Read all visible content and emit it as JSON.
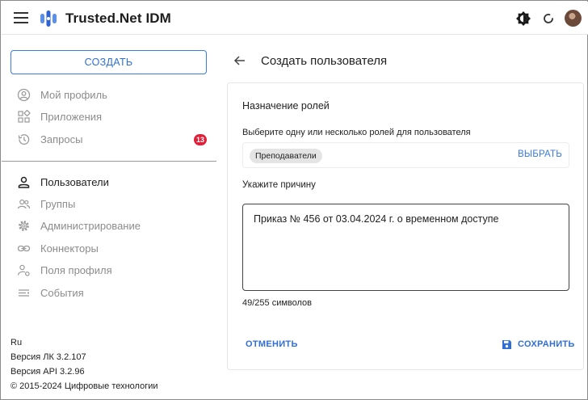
{
  "header": {
    "app_title": "Trusted.Net IDM",
    "icons": [
      "menu-icon",
      "app-logo",
      "theme-toggle-icon",
      "refresh-icon",
      "avatar"
    ]
  },
  "sidebar": {
    "create_label": "СОЗДАТЬ",
    "items_top": [
      {
        "label": "Мой профиль",
        "icon": "user-circle-icon"
      },
      {
        "label": "Приложения",
        "icon": "apps-icon"
      },
      {
        "label": "Запросы",
        "icon": "history-icon",
        "badge": "13"
      }
    ],
    "items_bottom": [
      {
        "label": "Пользователи",
        "icon": "user-icon",
        "active": true
      },
      {
        "label": "Группы",
        "icon": "group-icon"
      },
      {
        "label": "Администрирование",
        "icon": "gear-icon"
      },
      {
        "label": "Коннекторы",
        "icon": "link-icon"
      },
      {
        "label": "Поля профиля",
        "icon": "profile-fields-icon"
      },
      {
        "label": "События",
        "icon": "events-icon"
      }
    ],
    "footer": {
      "language": "Ru",
      "lk_version": "Версия ЛК 3.2.107",
      "api_version": "Версия API 3.2.96",
      "copyright": "© 2015-2024 Цифровые технологии"
    }
  },
  "main": {
    "page_title": "Создать пользователя",
    "card": {
      "section_title": "Назначение ролей",
      "roles_hint": "Выберите одну или несколько ролей для пользователя",
      "selected_role": "Преподаватели",
      "pick_label": "ВЫБРАТЬ",
      "reason_label": "Укажите причину",
      "reason_value": "Приказ № 456 от 03.04.2024 г. о временном доступе",
      "char_count": "49/255 символов",
      "cancel_label": "ОТМЕНИТЬ",
      "save_label": "СОХРАНИТЬ"
    }
  },
  "colors": {
    "accent": "#2f6fd6",
    "badge": "#e0203a",
    "chip": "#e4e4e4"
  }
}
